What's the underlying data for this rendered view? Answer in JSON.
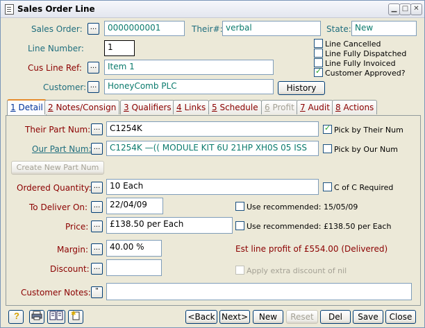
{
  "window": {
    "title": "Sales Order Line"
  },
  "header": {
    "sales_order_label": "Sales Order:",
    "sales_order_value": "0000000001",
    "their_label": "Their#:",
    "their_value": "verbal",
    "state_label": "State:",
    "state_value": "New",
    "line_number_label": "Line Number:",
    "line_number_value": "1",
    "cus_line_ref_label": "Cus Line Ref:",
    "cus_line_ref_value": "Item 1",
    "customer_label": "Customer:",
    "customer_value": "HoneyComb PLC",
    "history_label": "History",
    "dots_label": "...",
    "flags": [
      {
        "label": "Line Cancelled",
        "checked": false
      },
      {
        "label": "Line Fully Dispatched",
        "checked": false
      },
      {
        "label": "Line Fully Invoiced",
        "checked": false
      },
      {
        "label": "Customer Approved?",
        "checked": true
      }
    ]
  },
  "tabs": [
    {
      "key": "1",
      "label": "Detail",
      "state": "active"
    },
    {
      "key": "2",
      "label": "Notes/Consign",
      "state": "normal"
    },
    {
      "key": "3",
      "label": "Qualifiers",
      "state": "normal"
    },
    {
      "key": "4",
      "label": "Links",
      "state": "normal"
    },
    {
      "key": "5",
      "label": "Schedule",
      "state": "normal"
    },
    {
      "key": "6",
      "label": "Profit",
      "state": "disabled"
    },
    {
      "key": "7",
      "label": "Audit",
      "state": "normal"
    },
    {
      "key": "8",
      "label": "Actions",
      "state": "normal"
    }
  ],
  "detail": {
    "their_part_label": "Their Part Num:",
    "their_part_value": "C1254K",
    "pick_by_their_label": "Pick by Their Num",
    "pick_by_their_checked": true,
    "our_part_label": "Our Part Num:",
    "our_part_value": "C1254K    —(( MODULE KIT 6U 21HP XH0S 05 ISS",
    "pick_by_our_label": "Pick by Our Num",
    "pick_by_our_checked": false,
    "create_new_part_label": "Create New Part Num",
    "ordered_qty_label": "Ordered Quantity:",
    "ordered_qty_value": "10 Each",
    "c_of_c_label": "C of C Required",
    "c_of_c_checked": false,
    "to_deliver_label": "To Deliver On:",
    "to_deliver_value": "22/04/09",
    "use_rec_date_label": "Use recommended: 15/05/09",
    "use_rec_date_checked": false,
    "price_label": "Price:",
    "price_value": "£138.50 per Each",
    "use_rec_price_label": "Use recommended: £138.50 per Each",
    "use_rec_price_checked": false,
    "margin_label": "Margin:",
    "margin_value": "40.00 %",
    "est_profit_text": "Est line profit of £554.00 (Delivered)",
    "discount_label": "Discount:",
    "discount_value": "",
    "apply_discount_label": "Apply extra discount of nil",
    "apply_discount_checked": false,
    "customer_notes_label": "Customer Notes:",
    "customer_notes_value": "",
    "notes_btn_label": "\""
  },
  "footer": {
    "back_label": "<Back",
    "next_label": "Next>",
    "new_label": "New",
    "reset_label": "Reset",
    "del_label": "Del",
    "save_label": "Save",
    "close_label": "Close",
    "icons": [
      "help-icon",
      "print-icon",
      "list-icon",
      "new-doc-icon"
    ]
  },
  "colors": {
    "label_teal": "#1f6e7e",
    "label_red": "#8b0000",
    "value_teal": "#0a7a6c",
    "active_tab_orange": "#e68b2c"
  }
}
